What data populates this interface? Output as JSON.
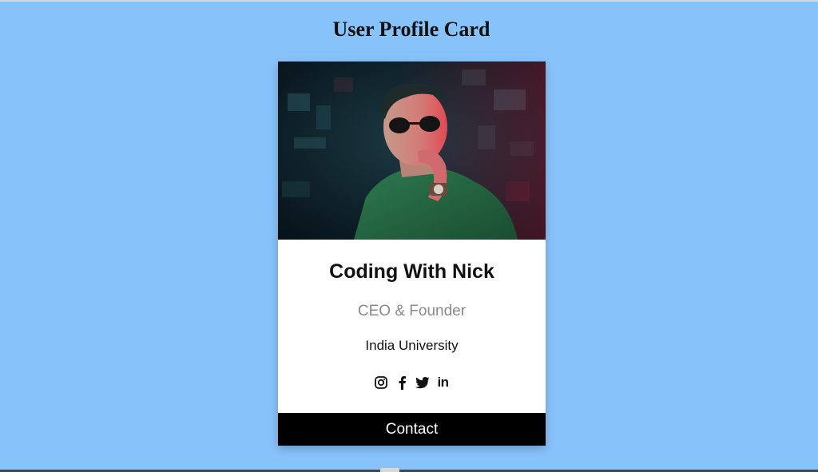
{
  "page": {
    "title": "User Profile Card"
  },
  "profile": {
    "name": "Coding With Nick",
    "role": "CEO & Founder",
    "organization": "India University",
    "photo_alt": "Profile photo"
  },
  "social": [
    {
      "name": "instagram",
      "icon": "instagram-icon"
    },
    {
      "name": "facebook",
      "icon": "facebook-icon"
    },
    {
      "name": "twitter",
      "icon": "twitter-icon"
    },
    {
      "name": "linkedin",
      "icon": "linkedin-icon",
      "text": "in"
    }
  ],
  "actions": {
    "contact_label": "Contact"
  },
  "colors": {
    "background": "#88c2fa",
    "card": "#ffffff",
    "contact_button": "#000000",
    "role_text": "#8a8a8a"
  }
}
